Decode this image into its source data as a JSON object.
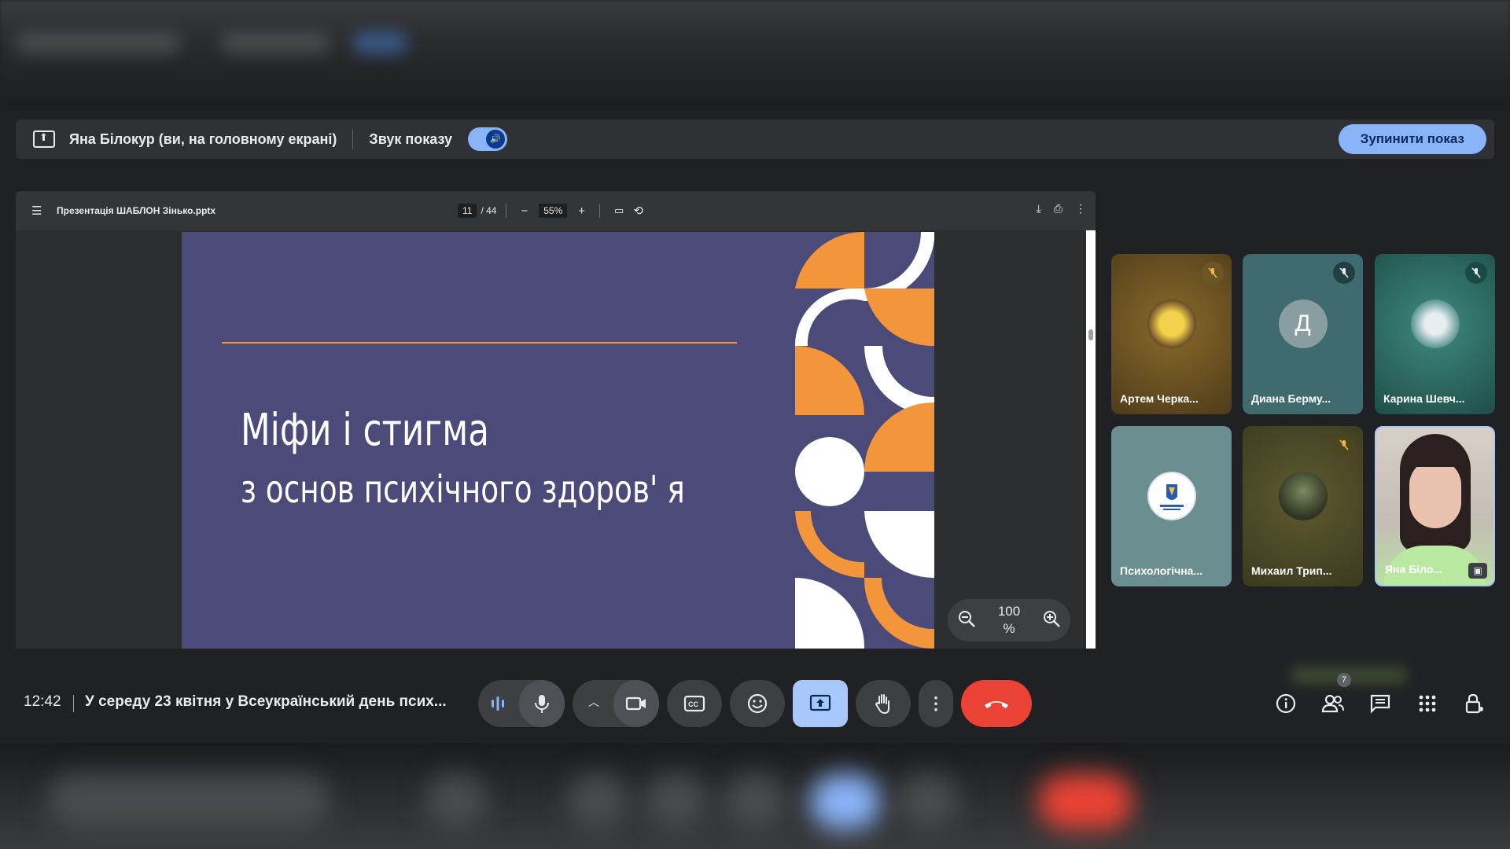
{
  "presenting_bar": {
    "presenter_text": "Яна Білокур (ви, на головному екрані)",
    "audio_label": "Звук показу",
    "stop_button": "Зупинити показ"
  },
  "viewer": {
    "file_name": "Презентація ШАБЛОН Зінько.pptx",
    "current_page": "11",
    "page_total": "/ 44",
    "zoom": "55%"
  },
  "slide": {
    "title": "Міфи і стигма",
    "subtitle": "з основ психічного здоров' я",
    "colors": {
      "background": "#4b4a78",
      "accent": "#f2953b",
      "white": "#ffffff"
    }
  },
  "zoom_overlay": {
    "value_line1": "100",
    "value_line2": "%"
  },
  "participants": [
    {
      "name": "Артем Черка...",
      "muted": true,
      "avatar_type": "image",
      "bg": "#6a5222"
    },
    {
      "name": "Диана Берму...",
      "muted": true,
      "avatar_type": "letter",
      "letter": "Д",
      "bg": "#3f6b6e"
    },
    {
      "name": "Карина Шевч...",
      "muted": true,
      "avatar_type": "image",
      "bg": "#2d6b62"
    },
    {
      "name": "Психологічна...",
      "muted": false,
      "avatar_type": "logo",
      "bg": "#6b8e90"
    },
    {
      "name": "Михаил Трип...",
      "muted": true,
      "avatar_type": "image",
      "bg": "#4a4a28"
    },
    {
      "name": "Яна Біло...",
      "muted": false,
      "avatar_type": "video",
      "bg": "#c9c0b4"
    }
  ],
  "bottom_bar": {
    "time": "12:42",
    "meeting_title": "У середу 23 квітня у Всеукраїнський день псих...",
    "participant_count": "7",
    "controls": [
      "audio-levels",
      "microphone",
      "more-options-up",
      "camera",
      "captions",
      "emoji",
      "present",
      "raise-hand",
      "more",
      "end-call"
    ],
    "accent_color": "#a8c7fa",
    "end_color": "#ea4335"
  }
}
